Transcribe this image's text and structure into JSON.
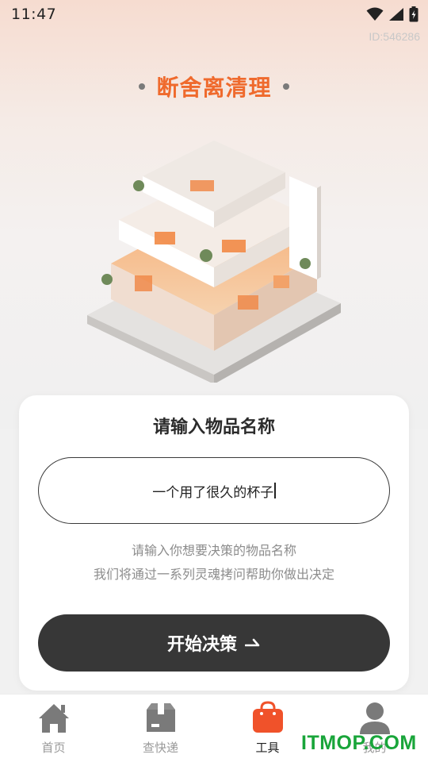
{
  "status": {
    "time": "11:47"
  },
  "id_label": "ID:546286",
  "title": "断舍离清理",
  "card": {
    "title": "请输入物品名称",
    "input_value": "一个用了很久的杯子",
    "hint_line1": "请输入你想要决策的物品名称",
    "hint_line2": "我们将通过一系列灵魂拷问帮助你做出决定",
    "start_label": "开始决策",
    "start_icon": "arrow-right-icon"
  },
  "tabs": [
    {
      "label": "首页",
      "icon": "home-icon",
      "active": false
    },
    {
      "label": "查快递",
      "icon": "package-icon",
      "active": false
    },
    {
      "label": "工具",
      "icon": "bag-icon",
      "active": true
    },
    {
      "label": "我的",
      "icon": "person-icon",
      "active": false
    }
  ],
  "watermark": "ITMOP.COM",
  "colors": {
    "accent": "#ef6a2d",
    "button": "#373737",
    "tool_tab": "#f0522a"
  }
}
